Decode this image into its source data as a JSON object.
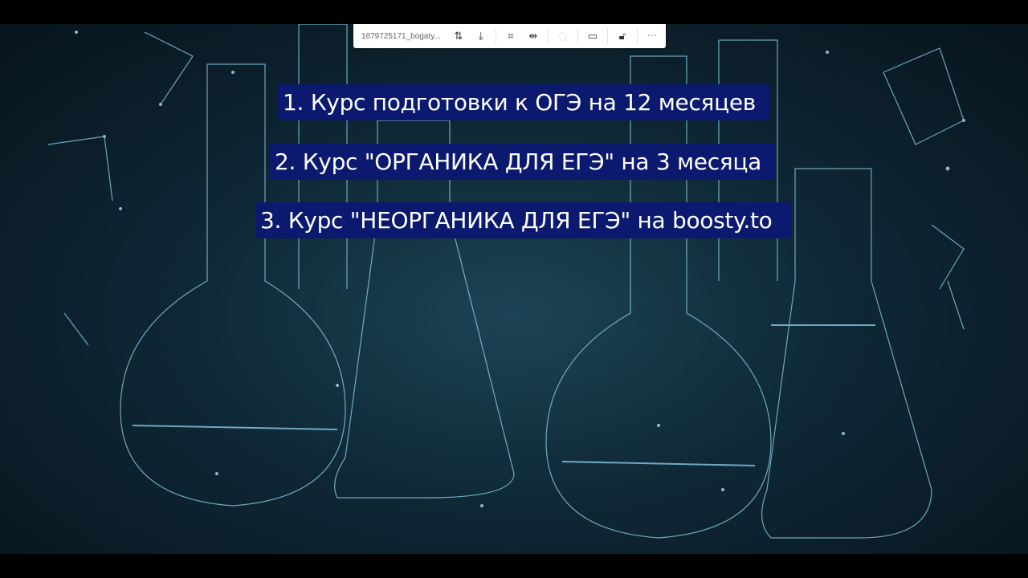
{
  "toolbar": {
    "filename": "1679725171_bogaty...",
    "icons": [
      "rotate-icon",
      "download-icon",
      "crop-icon",
      "resize-icon",
      "loading-icon",
      "comment-icon",
      "unlock-icon",
      "more-icon"
    ],
    "more": "···"
  },
  "content": {
    "lines": [
      "1. Курс подготовки к ОГЭ на 12 месяцев",
      "2. Курс \"ОРГАНИКА ДЛЯ ЕГЭ\" на 3 месяца",
      "3. Курс \"НЕОРГАНИКА ДЛЯ ЕГЭ\" на boosty.to"
    ]
  },
  "colors": {
    "label_bg": "#0b1a6e",
    "flask": "#8fd3f0"
  }
}
